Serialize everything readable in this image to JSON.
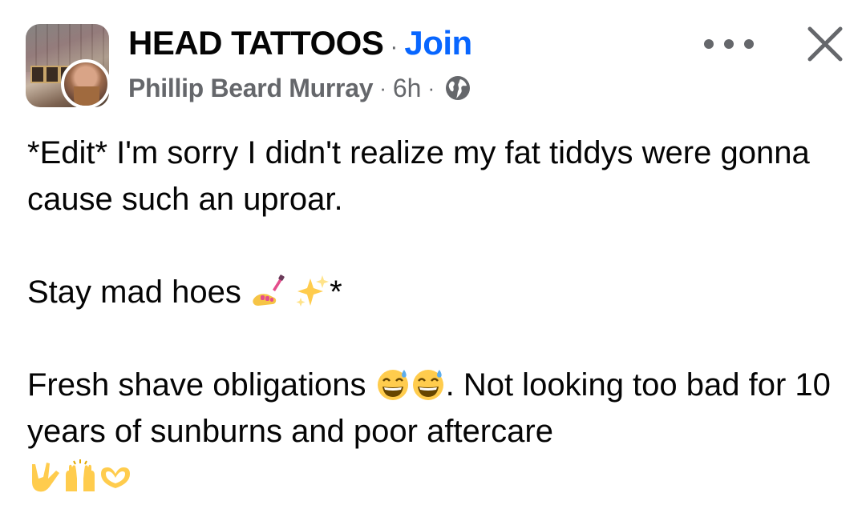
{
  "post": {
    "group_name": "HEAD TATTOOS",
    "join_label": "Join",
    "author": "Phillip Beard Murray",
    "time": "6h",
    "visibility_icon": "globe-icon",
    "actions": {
      "more_icon": "more-options-icon",
      "close_icon": "close-icon"
    },
    "text": {
      "line1": "*Edit* I'm sorry I didn't realize my fat tiddys were gonna cause such an uproar.",
      "line2_text": "Stay mad hoes",
      "line2_suffix": "*",
      "line3_text": "Fresh shave obligations",
      "line3_rest": ". Not looking too bad for 10 years of sunburns and poor aftercare"
    },
    "emojis": {
      "line2": [
        "nail-polish-emoji",
        "sparkles-emoji"
      ],
      "line3": [
        "grinning-sweat-emoji",
        "grinning-sweat-emoji"
      ],
      "line4": [
        "love-you-gesture-emoji",
        "raising-hands-emoji",
        "heart-hands-emoji"
      ]
    }
  },
  "colors": {
    "accent": "#0866ff",
    "secondary_text": "#65676b",
    "primary_text": "#050505"
  }
}
